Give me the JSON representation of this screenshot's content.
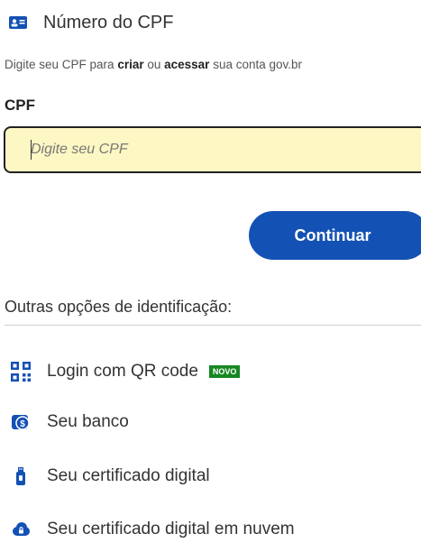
{
  "section": {
    "title": "Número do CPF",
    "icon": "id-card-icon"
  },
  "instruction": {
    "part1": "Digite seu CPF para ",
    "bold1": "criar",
    "part2": " ou ",
    "bold2": "acessar",
    "part3": " sua conta gov.br"
  },
  "cpf_field": {
    "label": "CPF",
    "placeholder": "Digite seu CPF",
    "value": ""
  },
  "continue_button": {
    "label": "Continuar"
  },
  "other_options": {
    "title": "Outras opções de identificação:",
    "items": [
      {
        "label": "Login com QR code",
        "icon": "qr-code-icon",
        "badge": "NOVO"
      },
      {
        "label": "Seu banco",
        "icon": "bank-icon"
      },
      {
        "label": "Seu certificado digital",
        "icon": "usb-token-icon"
      },
      {
        "label": "Seu certificado digital em nuvem",
        "icon": "cloud-lock-icon"
      }
    ]
  },
  "colors": {
    "primary": "#1351b4",
    "input_bg": "#fdf7c3",
    "badge_bg": "#168821",
    "text": "#333333"
  }
}
